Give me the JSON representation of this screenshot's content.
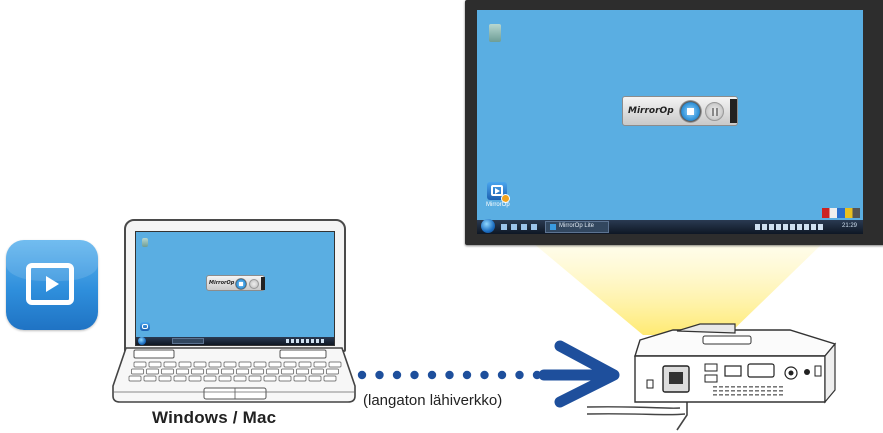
{
  "app": {
    "icon": "mirrorop-app-icon",
    "accent": "#2f8fdc"
  },
  "monitor_screen": {
    "desktop_icon_label": "MirrorOp",
    "widget_logo": "MirrorOp",
    "taskbar_button_label": "MirrorOp Lite",
    "clock": "21:29",
    "desktop_color": "#5aaee2"
  },
  "laptop_screen": {
    "widget_logo": "MirrorOp"
  },
  "labels": {
    "device": "Windows / Mac",
    "connection": "(langaton lähiverkko)"
  },
  "colors": {
    "arrow": "#1e4f9c",
    "beam": "#fff5b0"
  }
}
